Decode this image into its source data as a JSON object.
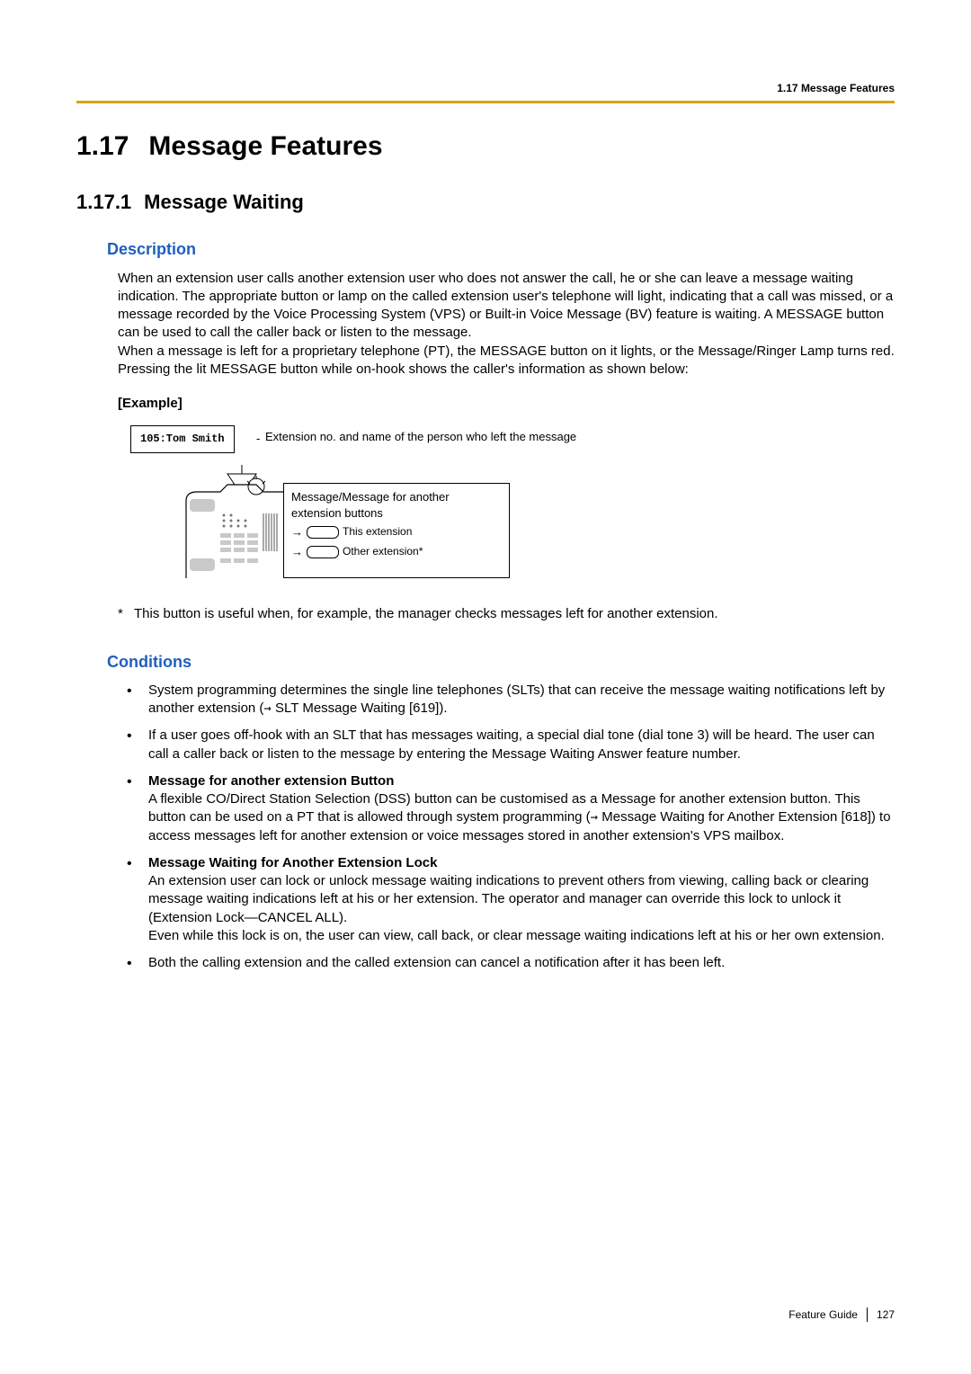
{
  "running_head": "1.17 Message Features",
  "h1_num": "1.17",
  "h1_text": "Message Features",
  "h2_num": "1.17.1",
  "h2_text": "Message Waiting",
  "description_head": "Description",
  "description_body": "When an extension user calls another extension user who does not answer the call, he or she can leave a message waiting indication. The appropriate button or lamp on the called extension user's telephone will light, indicating that a call was missed, or a message recorded by the Voice Processing System (VPS) or Built-in Voice Message (BV) feature is waiting. A MESSAGE button can be used to call the caller back or listen to the message.\nWhen a message is left for a proprietary telephone (PT), the MESSAGE button on it lights, or the Message/Ringer Lamp turns red. Pressing the lit MESSAGE button while on-hook shows the caller's information as shown below:",
  "example_label": "[Example]",
  "diagram": {
    "display_text": "105:Tom Smith",
    "display_desc_dash": "-",
    "display_desc": "Extension no. and name of the person who left the message",
    "box_title": "Message/Message for another extension buttons",
    "row1": "This extension",
    "row2": "Other extension*"
  },
  "footnote_star": "*",
  "footnote_text": "This button is useful when, for example, the manager checks messages left for another extension.",
  "conditions_head": "Conditions",
  "cond1_a": "System programming determines the single line telephones (SLTs) that can receive the message waiting notifications left by another extension (",
  "cond1_b": " SLT Message Waiting [619]).",
  "cond2": "If a user goes off-hook with an SLT that has messages waiting, a special dial tone (dial tone 3) will be heard. The user can call a caller back or listen to the message by entering the Message Waiting Answer feature number.",
  "cond3_title": "Message for another extension Button",
  "cond3_a": "A flexible CO/Direct Station Selection (DSS) button can be customised as a Message for another extension button. This button can be used on a PT that is allowed through system programming (",
  "cond3_b": " Message Waiting for Another Extension [618]) to access messages left for another extension or voice messages stored in another extension's VPS mailbox.",
  "cond4_title": "Message Waiting for Another Extension Lock",
  "cond4_body": "An extension user can lock or unlock message waiting indications to prevent others from viewing, calling back or clearing message waiting indications left at his or her extension. The operator and manager can override this lock to unlock it (Extension Lock—CANCEL ALL).\nEven while this lock is on, the user can view, call back, or clear message waiting indications left at his or her own extension.",
  "cond5": "Both the calling extension and the called extension can cancel a notification after it has been left.",
  "footer_guide": "Feature Guide",
  "footer_page": "127",
  "arrow_glyph": "→"
}
